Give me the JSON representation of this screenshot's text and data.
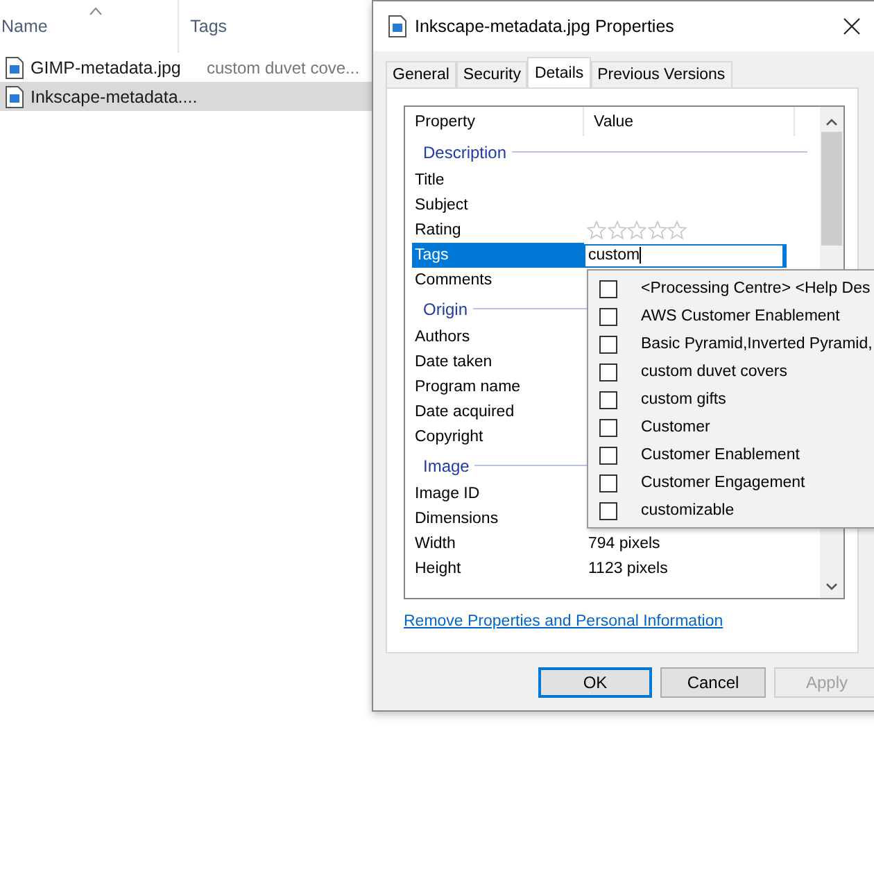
{
  "explorer": {
    "columns": [
      {
        "label": "Name",
        "sorted": true
      },
      {
        "label": "Tags",
        "sorted": false
      }
    ],
    "files": [
      {
        "name": "GIMP-metadata.jpg",
        "tags": "custom duvet cove...",
        "selected": false
      },
      {
        "name": "Inkscape-metadata....",
        "selected": true
      }
    ]
  },
  "dialog": {
    "title": "Inkscape-metadata.jpg Properties",
    "tabs": [
      {
        "label": "General",
        "selected": false
      },
      {
        "label": "Security",
        "selected": false
      },
      {
        "label": "Details",
        "selected": true
      },
      {
        "label": "Previous Versions",
        "selected": false
      }
    ],
    "columns": [
      "Property",
      "Value"
    ],
    "rows": [
      {
        "kind": "group",
        "label": "Description"
      },
      {
        "kind": "row",
        "label": "Title",
        "value": "",
        "selected": false
      },
      {
        "kind": "row",
        "label": "Subject",
        "value": "",
        "selected": false
      },
      {
        "kind": "rating",
        "label": "Rating",
        "stars": 0,
        "selected": false
      },
      {
        "kind": "edit",
        "label": "Tags",
        "value": "custom",
        "selected": true
      },
      {
        "kind": "row",
        "label": "Comments",
        "value": "",
        "selected": false
      },
      {
        "kind": "group",
        "label": "Origin"
      },
      {
        "kind": "row",
        "label": "Authors",
        "value": "",
        "selected": false
      },
      {
        "kind": "row",
        "label": "Date taken",
        "value": "",
        "selected": false
      },
      {
        "kind": "row",
        "label": "Program name",
        "value": "",
        "selected": false
      },
      {
        "kind": "row",
        "label": "Date acquired",
        "value": "",
        "selected": false
      },
      {
        "kind": "row",
        "label": "Copyright",
        "value": "",
        "selected": false
      },
      {
        "kind": "group",
        "label": "Image"
      },
      {
        "kind": "row",
        "label": "Image ID",
        "value": "",
        "selected": false
      },
      {
        "kind": "row",
        "label": "Dimensions",
        "value": "",
        "selected": false
      },
      {
        "kind": "row",
        "label": "Width",
        "value": "794 pixels",
        "selected": false
      },
      {
        "kind": "row",
        "label": "Height",
        "value": "1123 pixels",
        "selected": false
      }
    ],
    "suggestions": [
      {
        "label": "<Processing Centre> <Help Des",
        "checked": false
      },
      {
        "label": "AWS Customer Enablement",
        "checked": false
      },
      {
        "label": "Basic Pyramid,Inverted Pyramid,",
        "checked": false
      },
      {
        "label": "custom duvet covers",
        "checked": false
      },
      {
        "label": "custom gifts",
        "checked": false
      },
      {
        "label": "Customer",
        "checked": false
      },
      {
        "label": "Customer Enablement",
        "checked": false
      },
      {
        "label": "Customer Engagement",
        "checked": false
      },
      {
        "label": "customizable",
        "checked": false
      }
    ],
    "link": "Remove Properties and Personal Information",
    "buttons": [
      {
        "label": "OK",
        "kind": "default",
        "disabled": false
      },
      {
        "label": "Cancel",
        "kind": "normal",
        "disabled": false
      },
      {
        "label": "Apply",
        "kind": "normal",
        "disabled": true
      }
    ]
  }
}
